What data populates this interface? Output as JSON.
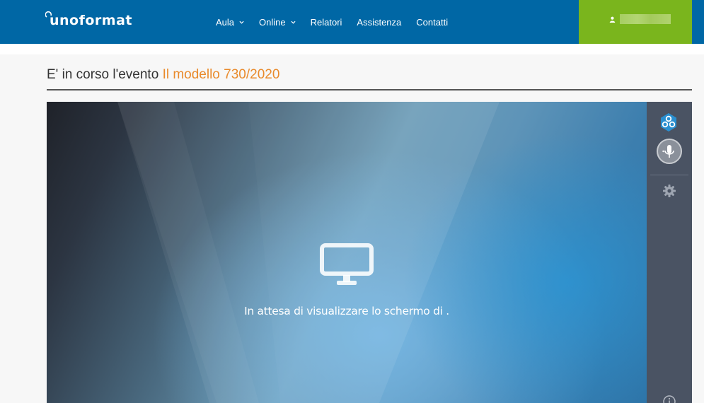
{
  "header": {
    "logo_text": "unoformat",
    "nav": [
      {
        "label": "Aula",
        "has_dropdown": true
      },
      {
        "label": "Online",
        "has_dropdown": true
      },
      {
        "label": "Relatori",
        "has_dropdown": false
      },
      {
        "label": "Assistenza",
        "has_dropdown": false
      },
      {
        "label": "Contatti",
        "has_dropdown": false
      }
    ],
    "user_icon": "user-icon"
  },
  "page": {
    "title_prefix": "E' in corso l'evento ",
    "event_name": "Il modello 730/2020"
  },
  "stage": {
    "icon": "monitor-icon",
    "waiting_text": "In attesa di visualizzare lo schermo di ."
  },
  "side_panel": {
    "icons": [
      "app-logo-icon",
      "microphone-icon",
      "gear-icon",
      "info-icon"
    ]
  },
  "colors": {
    "header_bg": "#0067a5",
    "user_box_bg": "#7ab51d",
    "event_accent": "#e98a2b",
    "side_panel_bg": "#4a5363"
  }
}
